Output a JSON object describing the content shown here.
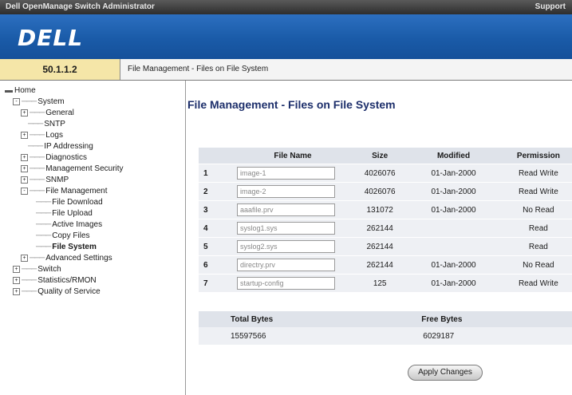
{
  "titlebar": {
    "app": "Dell OpenManage Switch Administrator",
    "support": "Support"
  },
  "logo": "DELL",
  "ip": "50.1.1.2",
  "breadcrumb": "File Management - Files on File System",
  "tree": [
    {
      "label": "Home",
      "level": 0,
      "exp": ""
    },
    {
      "label": "System",
      "level": 1,
      "exp": "-"
    },
    {
      "label": "General",
      "level": 2,
      "exp": "+"
    },
    {
      "label": "SNTP",
      "level": 2,
      "exp": ""
    },
    {
      "label": "Logs",
      "level": 2,
      "exp": "+"
    },
    {
      "label": "IP Addressing",
      "level": 2,
      "exp": ""
    },
    {
      "label": "Diagnostics",
      "level": 2,
      "exp": "+"
    },
    {
      "label": "Management Security",
      "level": 2,
      "exp": "+"
    },
    {
      "label": "SNMP",
      "level": 2,
      "exp": "+"
    },
    {
      "label": "File Management",
      "level": 2,
      "exp": "-"
    },
    {
      "label": "File Download",
      "level": 3,
      "exp": ""
    },
    {
      "label": "File Upload",
      "level": 3,
      "exp": ""
    },
    {
      "label": "Active Images",
      "level": 3,
      "exp": ""
    },
    {
      "label": "Copy Files",
      "level": 3,
      "exp": ""
    },
    {
      "label": "File System",
      "level": 3,
      "exp": "",
      "selected": true
    },
    {
      "label": "Advanced Settings",
      "level": 2,
      "exp": "+"
    },
    {
      "label": "Switch",
      "level": 1,
      "exp": "+"
    },
    {
      "label": "Statistics/RMON",
      "level": 1,
      "exp": "+"
    },
    {
      "label": "Quality of Service",
      "level": 1,
      "exp": "+"
    }
  ],
  "page_title": "File Management - Files on File System",
  "table": {
    "headers": [
      "File Name",
      "Size",
      "Modified",
      "Permission"
    ],
    "rows": [
      {
        "idx": "1",
        "name": "image-1",
        "size": "4026076",
        "modified": "01-Jan-2000",
        "perm": "Read Write"
      },
      {
        "idx": "2",
        "name": "image-2",
        "size": "4026076",
        "modified": "01-Jan-2000",
        "perm": "Read Write"
      },
      {
        "idx": "3",
        "name": "aaafile.prv",
        "size": "131072",
        "modified": "01-Jan-2000",
        "perm": "No Read"
      },
      {
        "idx": "4",
        "name": "syslog1.sys",
        "size": "262144",
        "modified": "",
        "perm": "Read"
      },
      {
        "idx": "5",
        "name": "syslog2.sys",
        "size": "262144",
        "modified": "",
        "perm": "Read"
      },
      {
        "idx": "6",
        "name": "directry.prv",
        "size": "262144",
        "modified": "01-Jan-2000",
        "perm": "No Read"
      },
      {
        "idx": "7",
        "name": "startup-config",
        "size": "125",
        "modified": "01-Jan-2000",
        "perm": "Read Write"
      }
    ]
  },
  "bytes": {
    "total_label": "Total Bytes",
    "total_value": "15597566",
    "free_label": "Free Bytes",
    "free_value": "6029187"
  },
  "apply_label": "Apply Changes"
}
